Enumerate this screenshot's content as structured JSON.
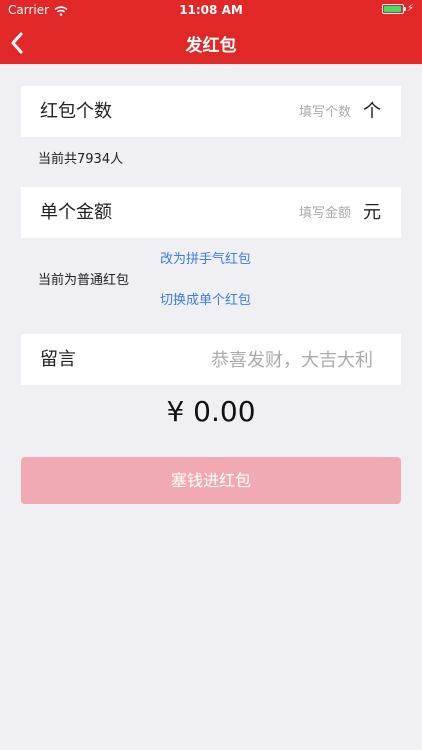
{
  "status_bar": {
    "carrier": "Carrier",
    "time": "11:08 AM",
    "wifi_icon": "wifi-icon",
    "battery_icon": "battery-icon",
    "charging_icon": "bolt-icon"
  },
  "nav": {
    "back_icon": "chevron-left-icon",
    "title": "发红包"
  },
  "count_field": {
    "label": "红包个数",
    "placeholder": "填写个数",
    "value": "",
    "unit": "个"
  },
  "total_people": "当前共7934人",
  "amount_field": {
    "label": "单个金额",
    "placeholder": "填写金额",
    "value": "",
    "unit": "元"
  },
  "packet_type": "当前为普通红包",
  "switch_lucky_link": "改为拼手气红包",
  "switch_single_link": "切换成单个红包",
  "message_field": {
    "label": "留言",
    "placeholder": "恭喜发财，大吉大利",
    "value": ""
  },
  "total_amount": "¥ 0.00",
  "submit_button": "塞钱进红包",
  "colors": {
    "nav_background": "#e02828",
    "page_background": "#efeff4",
    "link": "#3b7ddd",
    "submit_disabled": "#f2aab2",
    "battery_fill": "#4cd964"
  }
}
